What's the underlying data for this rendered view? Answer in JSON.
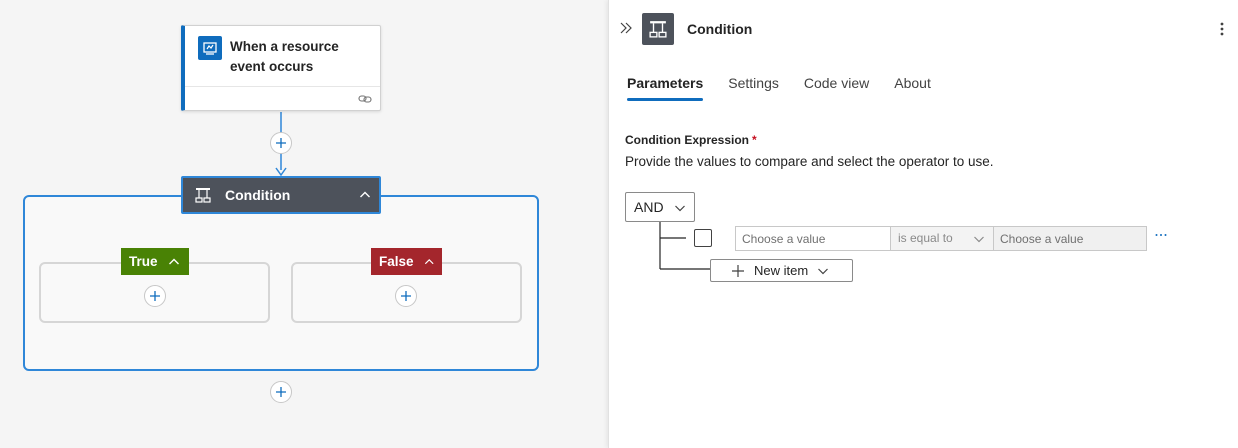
{
  "canvas": {
    "trigger": {
      "title": "When a resource event occurs",
      "icon": "event-grid-icon"
    },
    "condition": {
      "label": "Condition",
      "icon": "condition-icon"
    },
    "branches": {
      "true_label": "True",
      "false_label": "False"
    },
    "colors": {
      "accent": "#2f87d8",
      "true": "#498205",
      "false": "#a4262c",
      "action_header": "#4d525b",
      "trigger_bar": "#0f6cbd"
    }
  },
  "panel": {
    "title": "Condition",
    "tabs": [
      {
        "label": "Parameters",
        "active": true
      },
      {
        "label": "Settings",
        "active": false
      },
      {
        "label": "Code view",
        "active": false
      },
      {
        "label": "About",
        "active": false
      }
    ],
    "field": {
      "label": "Condition Expression",
      "required_marker": "*",
      "description": "Provide the values to compare and select the operator to use."
    },
    "group_operator": "AND",
    "row": {
      "left_placeholder": "Choose a value",
      "operator": "is equal to",
      "right_placeholder": "Choose a value",
      "checked": false
    },
    "new_item_label": "New item"
  }
}
